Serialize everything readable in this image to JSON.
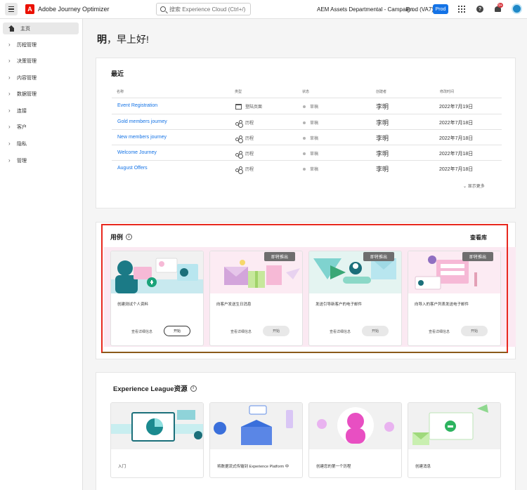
{
  "header": {
    "app_title": "Adobe Journey Optimizer",
    "logo_letter": "A",
    "search_placeholder": "搜索 Experience Cloud (Ctrl+/)",
    "org": "AEM Assets Departmental - Campaign",
    "sandbox": "Prod (VA7)",
    "prod_badge": "Prod",
    "help_glyph": "?",
    "notification_count": "9+"
  },
  "sidebar": {
    "home": "主页",
    "items": [
      "历程管理",
      "决策管理",
      "内容管理",
      "数据管理",
      "连接",
      "客户",
      "隐私",
      "管理"
    ]
  },
  "greeting": {
    "name": "明",
    "text": "，早上好!"
  },
  "recent": {
    "title": "最近",
    "columns": [
      "名称",
      "类型",
      "状态",
      "创建者",
      "修改时间"
    ],
    "rows": [
      {
        "name": "Event Registration",
        "type": "登陆页面",
        "status": "草稿",
        "creator": "李明",
        "date": "2022年7月19日"
      },
      {
        "name": "Gold members journey",
        "type": "历程",
        "status": "草稿",
        "creator": "李明",
        "date": "2022年7月18日"
      },
      {
        "name": "New members journey",
        "type": "历程",
        "status": "草稿",
        "creator": "李明",
        "date": "2022年7月18日"
      },
      {
        "name": "Welcome Journey",
        "type": "历程",
        "status": "草稿",
        "creator": "李明",
        "date": "2022年7月18日"
      },
      {
        "name": "August Offers",
        "type": "历程",
        "status": "草稿",
        "creator": "李明",
        "date": "2022年7月18日"
      }
    ],
    "show_more": "显示更多"
  },
  "use_cases": {
    "title": "用例",
    "gallery": "查看库",
    "cards": [
      {
        "label": "创建测试个人资料",
        "link": "查看详细信息",
        "button": "开始",
        "badge": ""
      },
      {
        "label": "向客户发送生日消息",
        "link": "查看详细信息",
        "button": "开始",
        "badge": "即将推出"
      },
      {
        "label": "发送引导新客户的电子邮件",
        "link": "查看详细信息",
        "button": "开始",
        "badge": "即将推出"
      },
      {
        "label": "向导入的客户列表发送电子邮件",
        "link": "查看详细信息",
        "button": "开始",
        "badge": "即将推出"
      }
    ]
  },
  "experience_league": {
    "title": "Experience League资源",
    "cards": [
      {
        "label": "入门"
      },
      {
        "label": "将数据流式传输到 Experience Platform 中"
      },
      {
        "label": "创建您的第一个历程"
      },
      {
        "label": "创建消息"
      }
    ]
  }
}
